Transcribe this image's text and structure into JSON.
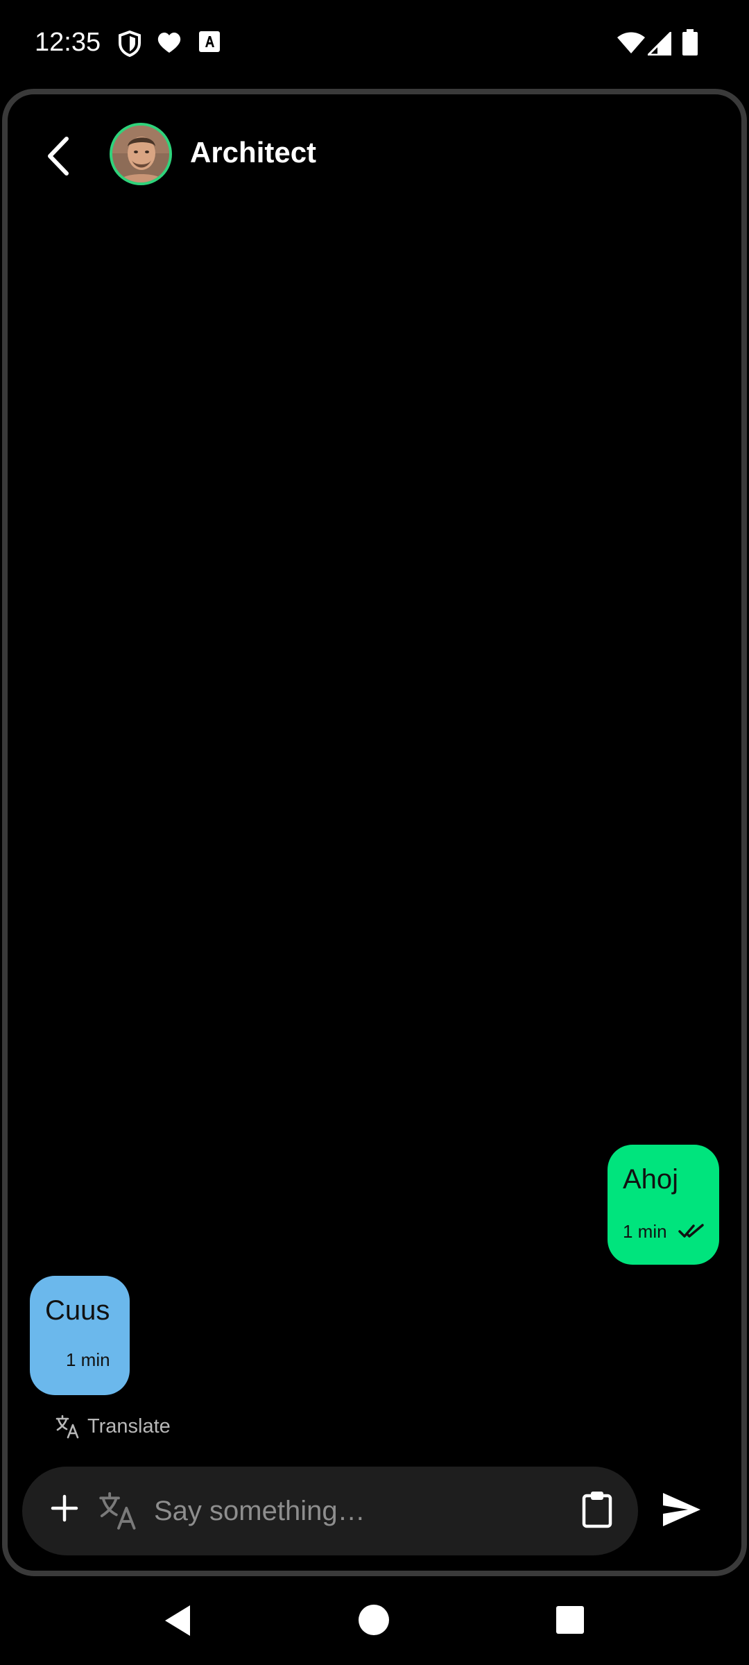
{
  "status_bar": {
    "time": "12:35",
    "icons": [
      "shield-icon",
      "heart-icon",
      "a-badge-icon",
      "wifi-icon",
      "cell-signal-icon",
      "battery-icon"
    ]
  },
  "header": {
    "back_icon": "chevron-left-icon",
    "contact_name": "Architect",
    "avatar_ring_color": "#2fd37b"
  },
  "messages": [
    {
      "direction": "outgoing",
      "text": "Ahoj",
      "time": "1 min",
      "status_icon": "double-check-icon",
      "bubble_color": "#00e47d"
    },
    {
      "direction": "incoming",
      "text": "Cuus",
      "time": "1 min",
      "bubble_color": "#6bb8ec"
    }
  ],
  "translate_link": {
    "label": "Translate",
    "icon": "translate-icon"
  },
  "composer": {
    "placeholder": "Say something…",
    "value": "",
    "icons": [
      "plus-icon",
      "translate-icon",
      "clipboard-icon"
    ]
  },
  "send_button": {
    "icon": "send-icon"
  },
  "nav_bar": {
    "icons": [
      "nav-back-icon",
      "nav-home-icon",
      "nav-recents-icon"
    ]
  }
}
